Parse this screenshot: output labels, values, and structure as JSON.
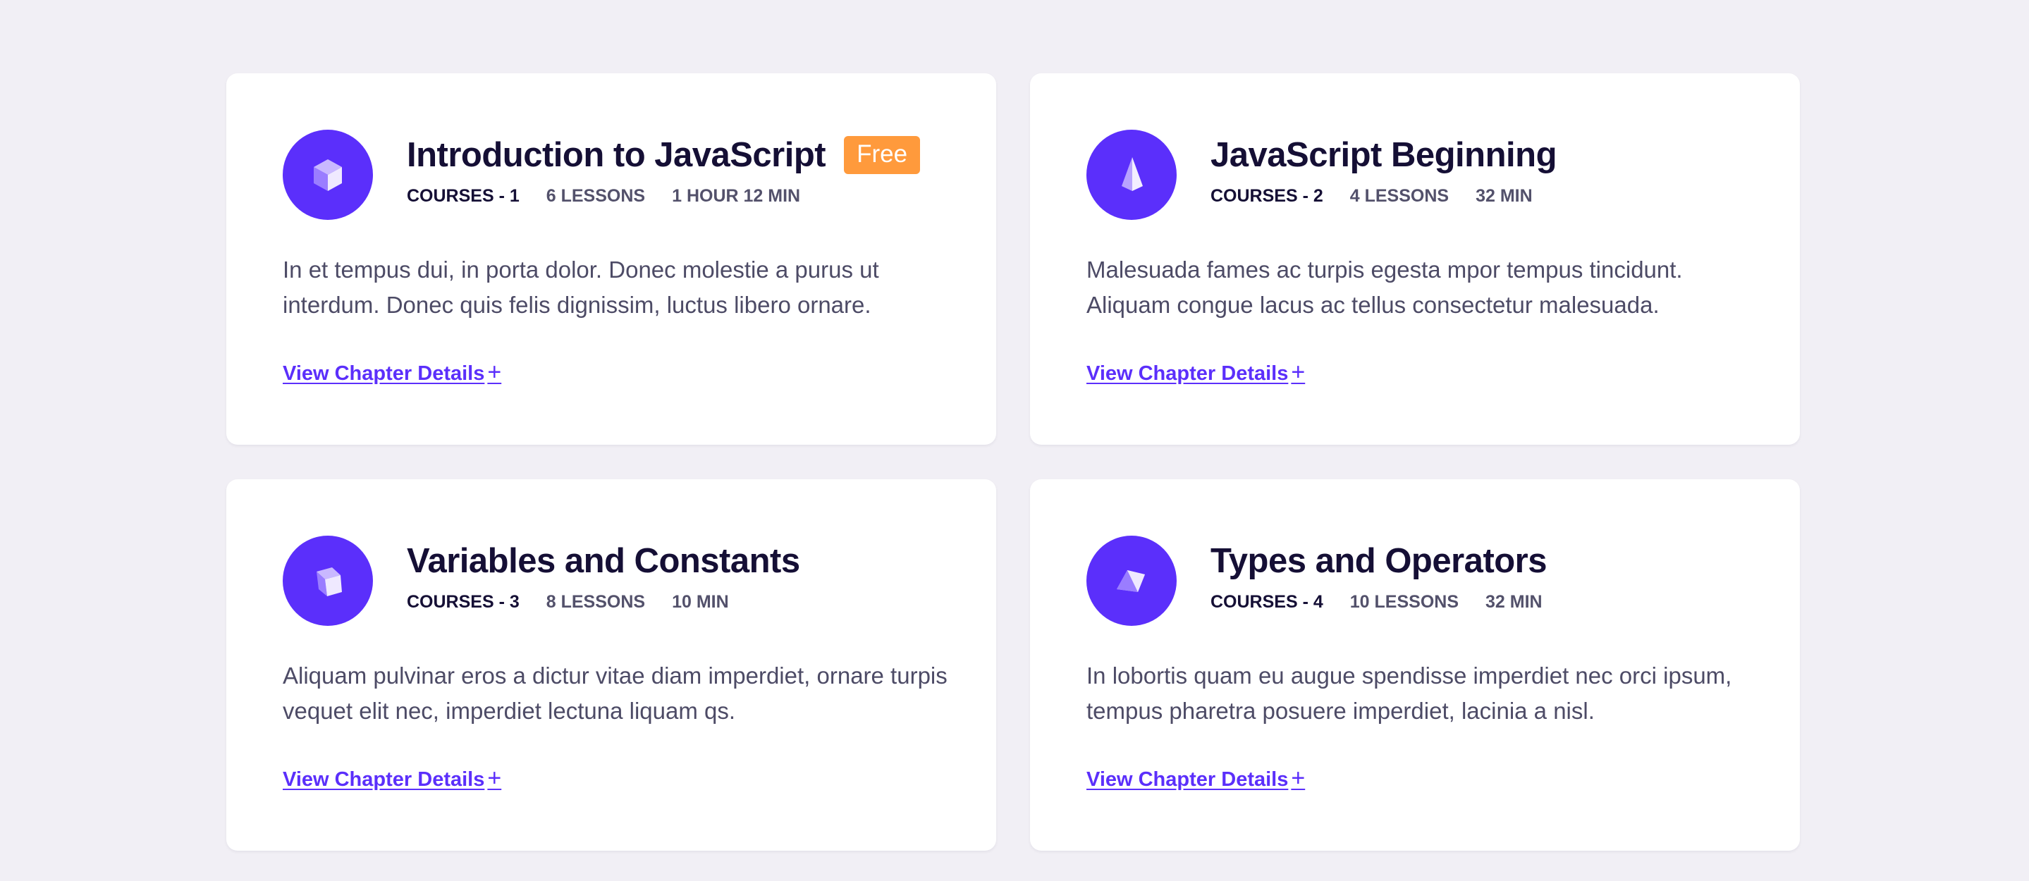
{
  "colors": {
    "background": "#f1eff5",
    "card": "#ffffff",
    "accent": "#5b2ffb",
    "badge": "#ff9a3c",
    "title": "#150f35",
    "muted": "#53516b"
  },
  "cards": [
    {
      "icon": "cube-icon",
      "title": "Introduction to JavaScript",
      "badge": "Free",
      "course": "COURSES - 1",
      "lessons": "6 LESSONS",
      "duration": "1 HOUR 12 MIN",
      "description": "In et tempus dui, in porta dolor. Donec molestie a purus ut interdum. Donec quis felis dignissim, luctus libero ornare.",
      "link": "View Chapter Details",
      "link_icon": "+"
    },
    {
      "icon": "pyramid-icon",
      "title": "JavaScript Beginning",
      "course": "COURSES - 2",
      "lessons": "4 LESSONS",
      "duration": "32 MIN",
      "description": "Malesuada fames ac turpis egesta mpor tempus tincidunt. Aliquam congue lacus ac tellus consectetur malesuada.",
      "link": "View Chapter Details",
      "link_icon": "+"
    },
    {
      "icon": "tilted-cube-icon",
      "title": "Variables and Constants",
      "course": "COURSES - 3",
      "lessons": "8 LESSONS",
      "duration": "10 MIN",
      "description": "Aliquam pulvinar eros a dictur vitae diam imperdiet, ornare turpis vequet elit nec, imperdiet lectuna liquam qs.",
      "link": "View Chapter Details",
      "link_icon": "+"
    },
    {
      "icon": "prism-icon",
      "title": "Types and Operators",
      "course": "COURSES - 4",
      "lessons": "10 LESSONS",
      "duration": "32 MIN",
      "description": "In lobortis quam eu augue spendisse imperdiet nec orci ipsum, tempus pharetra posuere imperdiet, lacinia a nisl.",
      "link": "View Chapter Details",
      "link_icon": "+"
    }
  ]
}
